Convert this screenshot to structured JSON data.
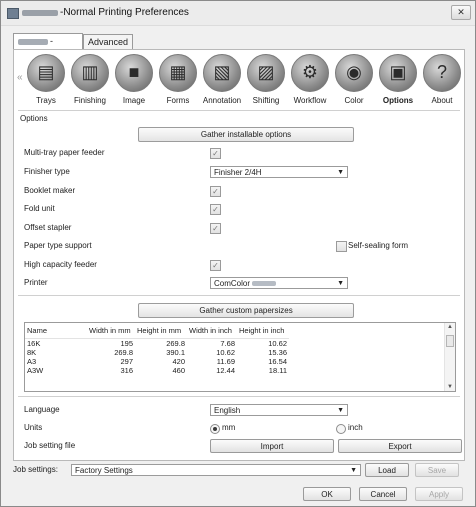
{
  "window": {
    "title": "-Normal Printing Preferences",
    "close": "✕"
  },
  "tabs": [
    {
      "label": "-Normal"
    },
    {
      "label": "Advanced"
    }
  ],
  "nav": {
    "left_arrow": "«",
    "right_arrow": "»",
    "items": [
      {
        "label": "Trays",
        "icon": "trays-icon",
        "glyph": "▤"
      },
      {
        "label": "Finishing",
        "icon": "finishing-icon",
        "glyph": "▥"
      },
      {
        "label": "Image",
        "icon": "image-icon",
        "glyph": "■"
      },
      {
        "label": "Forms",
        "icon": "forms-icon",
        "glyph": "▦"
      },
      {
        "label": "Annotation",
        "icon": "annotation-icon",
        "glyph": "▧"
      },
      {
        "label": "Shifting",
        "icon": "shifting-icon",
        "glyph": "▨"
      },
      {
        "label": "Workflow",
        "icon": "workflow-icon",
        "glyph": "⚙"
      },
      {
        "label": "Color",
        "icon": "color-icon",
        "glyph": "◉"
      },
      {
        "label": "Options",
        "icon": "options-icon",
        "glyph": "▣"
      },
      {
        "label": "About",
        "icon": "about-icon",
        "glyph": "?"
      }
    ],
    "selected": "Options"
  },
  "section_title": "Options",
  "gather_options_button": "Gather installable options",
  "options": {
    "multi_tray": {
      "label": "Multi-tray paper feeder",
      "checked": "✓"
    },
    "finisher": {
      "label": "Finisher type",
      "value": "Finisher 2/4H"
    },
    "booklet": {
      "label": "Booklet maker",
      "checked": "✓"
    },
    "fold": {
      "label": "Fold unit",
      "checked": "✓"
    },
    "offset": {
      "label": "Offset stapler",
      "checked": "✓"
    },
    "paper_type": {
      "label": "Paper type support",
      "self_sealing": "Self-sealing form"
    },
    "high_cap": {
      "label": "High capacity feeder",
      "checked": "✓"
    },
    "printer": {
      "label": "Printer",
      "value": "ComColor"
    }
  },
  "gather_custom_button": "Gather custom papersizes",
  "paper_table": {
    "headers": [
      "Name",
      "Width in mm",
      "Height in mm",
      "Width in inch",
      "Height in inch"
    ],
    "rows": [
      [
        "16K",
        "195",
        "269.8",
        "7.68",
        "10.62"
      ],
      [
        "8K",
        "269.8",
        "390.1",
        "10.62",
        "15.36"
      ],
      [
        "A3",
        "297",
        "420",
        "11.69",
        "16.54"
      ],
      [
        "A3W",
        "316",
        "460",
        "12.44",
        "18.11"
      ]
    ]
  },
  "language": {
    "label": "Language",
    "value": "English"
  },
  "units": {
    "label": "Units",
    "mm": "mm",
    "inch": "inch"
  },
  "job_file": {
    "label": "Job setting file",
    "import": "Import",
    "export": "Export"
  },
  "job_settings": {
    "label": "Job settings:",
    "value": "Factory Settings",
    "load": "Load",
    "save": "Save"
  },
  "dialog_buttons": {
    "ok": "OK",
    "cancel": "Cancel",
    "apply": "Apply"
  }
}
